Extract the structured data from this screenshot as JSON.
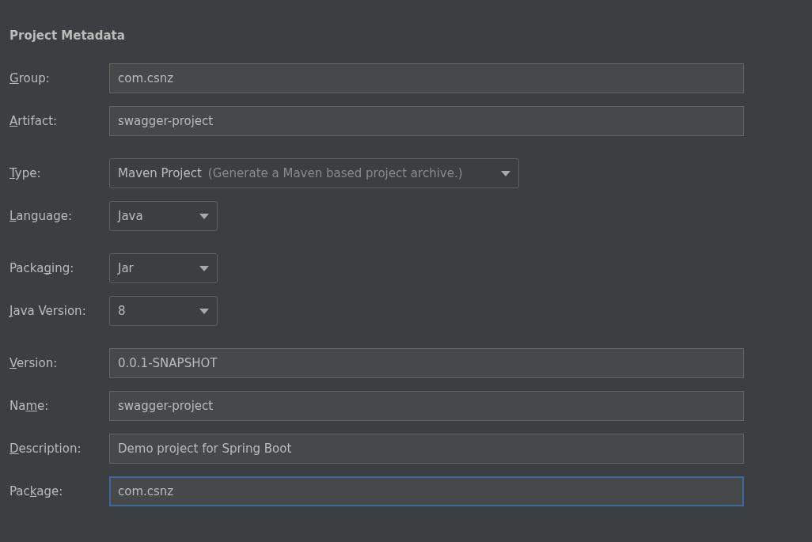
{
  "heading": "Project Metadata",
  "sections": [
    [
      {
        "label": [
          {
            "text": "G",
            "underlined": true
          },
          {
            "text": "roup:",
            "underlined": false
          }
        ],
        "kind": "text",
        "value": "com.csnz",
        "focused": false
      },
      {
        "label": [
          {
            "text": "A",
            "underlined": true
          },
          {
            "text": "rtifact:",
            "underlined": false
          }
        ],
        "kind": "text",
        "value": "swagger-project",
        "focused": false
      }
    ],
    [
      {
        "label": [
          {
            "text": "T",
            "underlined": true
          },
          {
            "text": "ype:",
            "underlined": false
          }
        ],
        "kind": "select",
        "value": "Maven Project",
        "hint": "(Generate a Maven based project archive.)"
      },
      {
        "label": [
          {
            "text": "L",
            "underlined": true
          },
          {
            "text": "anguage:",
            "underlined": false
          }
        ],
        "kind": "select",
        "value": "Java"
      }
    ],
    [
      {
        "label": [
          {
            "text": "Packa",
            "underlined": false
          },
          {
            "text": "g",
            "underlined": true
          },
          {
            "text": "ing:",
            "underlined": false
          }
        ],
        "kind": "select",
        "value": "Jar"
      },
      {
        "label": [
          {
            "text": "J",
            "underlined": true
          },
          {
            "text": "ava Version:",
            "underlined": false
          }
        ],
        "kind": "select",
        "value": "8"
      }
    ],
    [
      {
        "label": [
          {
            "text": "V",
            "underlined": true
          },
          {
            "text": "ersion:",
            "underlined": false
          }
        ],
        "kind": "text",
        "value": "0.0.1-SNAPSHOT",
        "focused": false
      },
      {
        "label": [
          {
            "text": "Na",
            "underlined": false
          },
          {
            "text": "m",
            "underlined": true
          },
          {
            "text": "e:",
            "underlined": false
          }
        ],
        "kind": "text",
        "value": "swagger-project",
        "focused": false
      },
      {
        "label": [
          {
            "text": "D",
            "underlined": true
          },
          {
            "text": "escription:",
            "underlined": false
          }
        ],
        "kind": "text",
        "value": "Demo project for Spring Boot",
        "focused": false
      },
      {
        "label": [
          {
            "text": "Pac",
            "underlined": false
          },
          {
            "text": "k",
            "underlined": true
          },
          {
            "text": "age:",
            "underlined": false
          }
        ],
        "kind": "text",
        "value": "com.csnz",
        "focused": true
      }
    ]
  ]
}
